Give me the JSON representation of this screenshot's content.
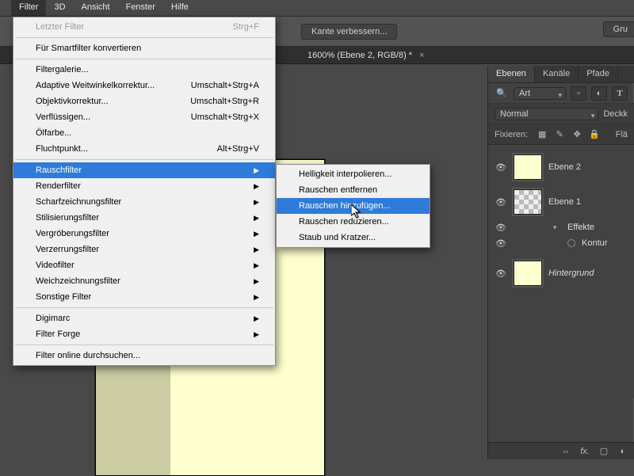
{
  "menubar": [
    "Filter",
    "3D",
    "Ansicht",
    "Fenster",
    "Hilfe"
  ],
  "menubar_active": 0,
  "optionsbar": {
    "refine": "Kante verbessern...",
    "group_btn": "Gru"
  },
  "doc_tab": "1600% (Ebene 2, RGB/8) *",
  "panels": {
    "tabs": [
      "Ebenen",
      "Kanäle",
      "Pfade"
    ],
    "art_dropdown": "Art",
    "blend_mode": "Normal",
    "opacity_lbl": "Deckk",
    "fix_label": "Fixieren:",
    "fill_lbl": "Flä"
  },
  "layers": [
    {
      "name": "Ebene 2",
      "thumb": "cream",
      "visible": true
    },
    {
      "name": "Ebene 1",
      "thumb": "checker",
      "visible": true,
      "effects": [
        {
          "label": "Effekte"
        },
        {
          "label": "Kontur"
        }
      ]
    },
    {
      "name": "Hintergrund",
      "thumb": "cream",
      "visible": true,
      "italic": true
    }
  ],
  "filter_menu": {
    "items": [
      {
        "label": "Letzter Filter",
        "shortcut": "Strg+F",
        "disabled": true
      },
      {
        "sep": true
      },
      {
        "label": "Für Smartfilter konvertieren"
      },
      {
        "sep": true
      },
      {
        "label": "Filtergalerie..."
      },
      {
        "label": "Adaptive Weitwinkelkorrektur...",
        "shortcut": "Umschalt+Strg+A"
      },
      {
        "label": "Objektivkorrektur...",
        "shortcut": "Umschalt+Strg+R"
      },
      {
        "label": "Verflüssigen...",
        "shortcut": "Umschalt+Strg+X"
      },
      {
        "label": "Ölfarbe..."
      },
      {
        "label": "Fluchtpunkt...",
        "shortcut": "Alt+Strg+V"
      },
      {
        "sep": true
      },
      {
        "label": "Rauschfilter",
        "submenu": true,
        "hi": true
      },
      {
        "label": "Renderfilter",
        "submenu": true
      },
      {
        "label": "Scharfzeichnungsfilter",
        "submenu": true
      },
      {
        "label": "Stilisierungsfilter",
        "submenu": true
      },
      {
        "label": "Vergröberungsfilter",
        "submenu": true
      },
      {
        "label": "Verzerrungsfilter",
        "submenu": true
      },
      {
        "label": "Videofilter",
        "submenu": true
      },
      {
        "label": "Weichzeichnungsfilter",
        "submenu": true
      },
      {
        "label": "Sonstige Filter",
        "submenu": true
      },
      {
        "sep": true
      },
      {
        "label": "Digimarc",
        "submenu": true
      },
      {
        "label": "Filter Forge",
        "submenu": true
      },
      {
        "sep": true
      },
      {
        "label": "Filter online durchsuchen..."
      }
    ]
  },
  "submenu": {
    "items": [
      {
        "label": "Helligkeit interpolieren..."
      },
      {
        "label": "Rauschen entfernen"
      },
      {
        "label": "Rauschen hinzufügen...",
        "hi": true
      },
      {
        "label": "Rauschen reduzieren..."
      },
      {
        "label": "Staub und Kratzer..."
      }
    ]
  }
}
